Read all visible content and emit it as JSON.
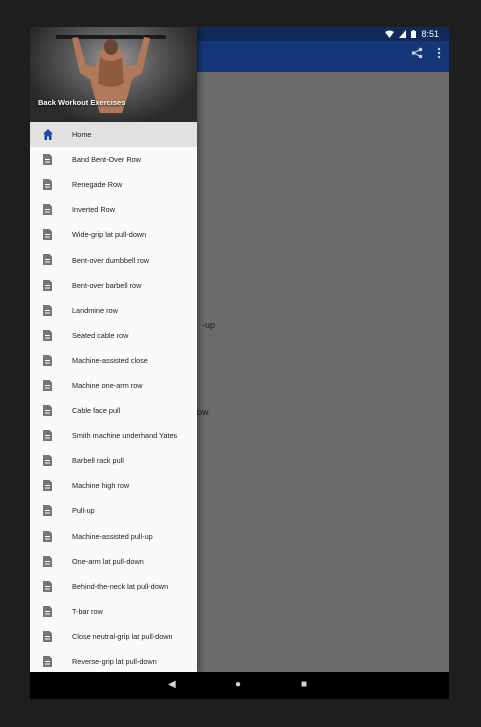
{
  "status_bar": {
    "time": "8:51"
  },
  "drawer": {
    "title": "Back Workout Exercises",
    "items": [
      {
        "label": "Home",
        "icon": "home-icon"
      },
      {
        "label": "Band Bent-Over Row",
        "icon": "document-icon"
      },
      {
        "label": "Renegade Row",
        "icon": "document-icon"
      },
      {
        "label": "Inverted Row",
        "icon": "document-icon"
      },
      {
        "label": "Wide-grip lat pull-down",
        "icon": "document-icon"
      },
      {
        "label": "Bent-over dumbbell row",
        "icon": "document-icon"
      },
      {
        "label": "Bent-over barbell row",
        "icon": "document-icon"
      },
      {
        "label": "Landmine row",
        "icon": "document-icon"
      },
      {
        "label": "Seated cable row",
        "icon": "document-icon"
      },
      {
        "label": "Machine-assisted close",
        "icon": "document-icon"
      },
      {
        "label": "Machine one-arm row",
        "icon": "document-icon"
      },
      {
        "label": "Cable face pull",
        "icon": "document-icon"
      },
      {
        "label": "Smith machine underhand Yates",
        "icon": "document-icon"
      },
      {
        "label": "Barbell rack pull",
        "icon": "document-icon"
      },
      {
        "label": "Machine high row",
        "icon": "document-icon"
      },
      {
        "label": "Pull-up",
        "icon": "document-icon"
      },
      {
        "label": "Machine-assisted pull-up",
        "icon": "document-icon"
      },
      {
        "label": "One-arm lat pull-down",
        "icon": "document-icon"
      },
      {
        "label": "Behind-the-neck lat pull-down",
        "icon": "document-icon"
      },
      {
        "label": "T-bar row",
        "icon": "document-icon"
      },
      {
        "label": "Close neutral-grip lat pull-down",
        "icon": "document-icon"
      },
      {
        "label": "Reverse-grip lat pull-down",
        "icon": "document-icon"
      }
    ]
  },
  "background_content": {
    "fragment_1": "-up",
    "fragment_2": "ow"
  },
  "colors": {
    "status_bar": "#102a5b",
    "app_bar": "#153779",
    "accent": "#1a47a8",
    "scrim": "#5f5f5f"
  }
}
